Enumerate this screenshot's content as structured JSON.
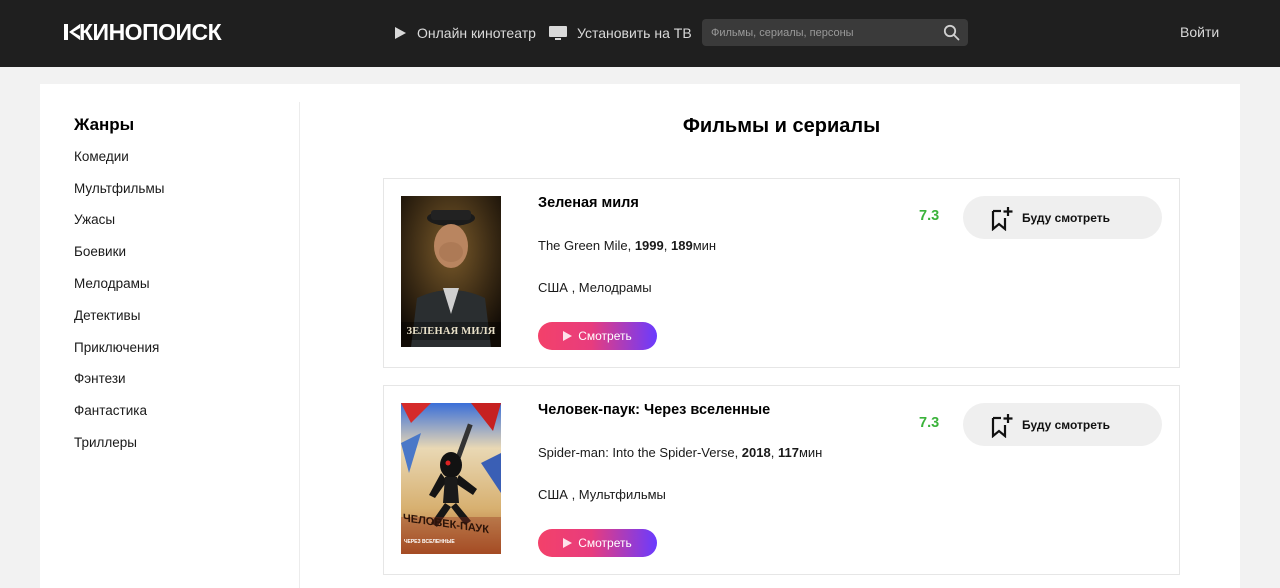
{
  "header": {
    "logo_text": "КИНОПОИСК",
    "nav": [
      {
        "label": "Онлайн кинотеатр",
        "icon": "play-icon"
      },
      {
        "label": "Установить на ТВ",
        "icon": "tv-icon"
      }
    ],
    "search": {
      "placeholder": "Фильмы, сериалы, персоны",
      "value": ""
    },
    "login_label": "Войти"
  },
  "sidebar": {
    "title": "Жанры",
    "genres": [
      "Комедии",
      "Мультфильмы",
      "Ужасы",
      "Боевики",
      "Мелодрамы",
      "Детективы",
      "Приключения",
      "Фэнтези",
      "Фантастика",
      "Триллеры"
    ]
  },
  "main": {
    "title": "Фильмы и сериалы",
    "movies": [
      {
        "title": "Зеленая миля",
        "original_title": "The Green Mile",
        "year": "1999",
        "duration": "189",
        "duration_unit": "мин",
        "country_genre": "США , Мелодрамы",
        "rating": "7.3",
        "watch_label": "Смотреть",
        "later_label": "Буду смотреть",
        "poster_caption": "ЗЕЛЕНАЯ МИЛЯ"
      },
      {
        "title": "Человек-паук: Через вселенные",
        "original_title": "Spider-man: Into the Spider-Verse",
        "year": "2018",
        "duration": "117",
        "duration_unit": "мин",
        "country_genre": "США , Мультфильмы",
        "rating": "7.3",
        "watch_label": "Смотреть",
        "later_label": "Буду смотреть",
        "poster_caption": "ЧЕЛОВЕК-ПАУК",
        "poster_subcaption": "ЧЕРЕЗ ВСЕЛЕННЫЕ"
      }
    ]
  },
  "colors": {
    "header_bg": "#1f1f1f",
    "rating_green": "#3bb33b",
    "watch_gradient_start": "#f3416a",
    "watch_gradient_end": "#6a3bff"
  }
}
